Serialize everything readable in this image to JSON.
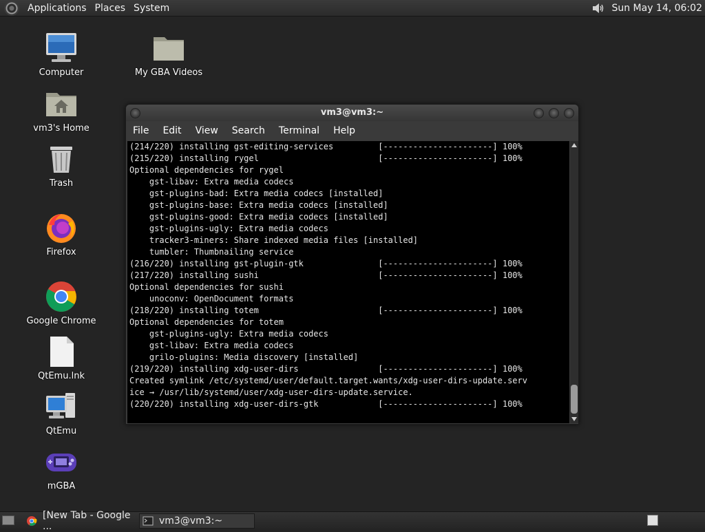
{
  "top_panel": {
    "menus": [
      "Applications",
      "Places",
      "System"
    ],
    "clock": "Sun May 14, 06:02"
  },
  "desktop_icons": [
    {
      "label": "Computer"
    },
    {
      "label": "vm3's Home"
    },
    {
      "label": "Trash"
    },
    {
      "label": "Firefox"
    },
    {
      "label": "Google Chrome"
    },
    {
      "label": "QtEmu.lnk"
    },
    {
      "label": "QtEmu"
    },
    {
      "label": "mGBA"
    },
    {
      "label": "My GBA Videos"
    }
  ],
  "terminal": {
    "title": "vm3@vm3:~",
    "menu": [
      "File",
      "Edit",
      "View",
      "Search",
      "Terminal",
      "Help"
    ],
    "lines": [
      "(214/220) installing gst-editing-services         [----------------------] 100%",
      "(215/220) installing rygel                        [----------------------] 100%",
      "Optional dependencies for rygel",
      "    gst-libav: Extra media codecs",
      "    gst-plugins-bad: Extra media codecs [installed]",
      "    gst-plugins-base: Extra media codecs [installed]",
      "    gst-plugins-good: Extra media codecs [installed]",
      "    gst-plugins-ugly: Extra media codecs",
      "    tracker3-miners: Share indexed media files [installed]",
      "    tumbler: Thumbnailing service",
      "(216/220) installing gst-plugin-gtk               [----------------------] 100%",
      "(217/220) installing sushi                        [----------------------] 100%",
      "Optional dependencies for sushi",
      "    unoconv: OpenDocument formats",
      "(218/220) installing totem                        [----------------------] 100%",
      "Optional dependencies for totem",
      "    gst-plugins-ugly: Extra media codecs",
      "    gst-libav: Extra media codecs",
      "    grilo-plugins: Media discovery [installed]",
      "(219/220) installing xdg-user-dirs                [----------------------] 100%",
      "Created symlink /etc/systemd/user/default.target.wants/xdg-user-dirs-update.serv",
      "ice → /usr/lib/systemd/user/xdg-user-dirs-update.service.",
      "(220/220) installing xdg-user-dirs-gtk            [----------------------] 100%"
    ]
  },
  "taskbar": {
    "items": [
      "[New Tab - Google ...",
      "vm3@vm3:~"
    ]
  },
  "colors": {
    "desktop_bg": "#242424",
    "terminal_bg": "#000000",
    "terminal_fg": "#e6e6e6"
  }
}
